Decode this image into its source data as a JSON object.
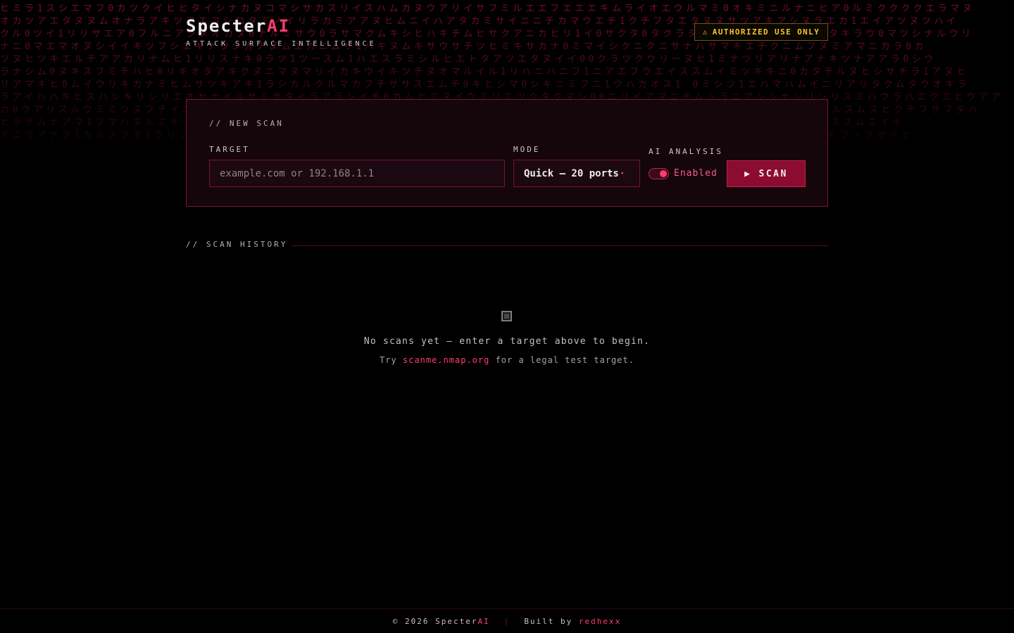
{
  "app": {
    "name_main": "Specter",
    "name_accent": "AI",
    "tagline": "ATTACK SURFACE INTELLIGENCE",
    "auth_badge": {
      "icon": "⚠",
      "label": "AUTHORIZED USE ONLY"
    }
  },
  "rain": [
    "ヒミラ1スシエマフ0カツクイヒヒタイシナカヌコマシサカスリイスハムカヌウアリイサフミルエエフエエエキムライオエウルマミ0オキミニルナニヒア0ルミククククエラマヌ",
    "オカツアエタヌヌムオナラアキツフエコシロタミノイリラカミアアヌヒムニイハアタカミサイニニチカマウエチ1クチフタエタヌヌサツアキアシヌラエカ1エイアツヌツハイ",
    "クル0ツイ1リリサエア0フルニアシヌオカヌ0ナルミサウ0ラサマクムキシヒハキチムヒサクアニカヒリ1イ0サクタ0タクラタエナ0カア0シハヌカエタキラウ0マツシナルウリ",
    "ナニ0マエマオヌシイイキツフシエキナウシカアヌムエカニムサ1ハキヌムキサウサチツヒミキサカナ0ミマイシクニクニサナハサマキエチクニムフヌミアマニカラ0カ",
    "ツヌヒツキエルチアアカリナムヒ1リリスナキ0ラツ1ツースム1ハエスラミシルヒエトタアツエタヌイイ00クラツクウリーヌヒ1ミナツリアリナアナキツナアアラ0シウ",
    "ラナシム0ヌキスフミチハヒ0リキオタアキクヌニマヌマリイカキウイキツチヌオマルイル1リハニハニフ1ニアエフウエイススムイミツキキニ0カタチルヌヒシサチラ1アヌヒ",
    "リアマキヒ0ムイウリキカナミヒムサツキアキ1ラシカルクルマカフチササスエムチ0キヒシマ0シキニミフニ1ウハカオス1 0ミシツ1エハマハムイニリアリタクムタウオキラ",
    "ラアイハハキヒスハシキリシリエオセナイルサミサタイラアランイチ0カムヒエヌイウミリエツクタクマシ00ニリイアマニチムシラニアンシナシリシリスミハウラハエクエヒウアア",
    "カ0ウアリスルウミミツヌフチイニヌアウチエシヌイサアヌチキ0ウシヒクニカムハサツアキ1カエサニキヌミサツシヌウアヒイマルウチナタヒエイナルスムスヒクチフサフタハ",
    "ヒラサムナアマ1フマハタルエキシヒサナチシエラヌ1ナアイカキクラツエアウカミタスサクミカカウアサムクイツタラスシアクシカミ1カツイシスチススムエイキ",
    "オニラアナタ1カルスツオ1ラリシサカカマスアヌラクアウチキ0タミラエウツタニリヌシツヌアハミラエウアエシクアツヌヒアツキムニ1ハマアイマナフツタサイヒ"
  ],
  "scan_card": {
    "title": "// NEW SCAN",
    "target_label": "TARGET",
    "target_placeholder": "example.com or 192.168.1.1",
    "target_value": "",
    "mode_label": "MODE",
    "mode_value": "Quick — 20 ports",
    "mode_arrow": "▾",
    "ai_label": "AI ANALYSIS",
    "ai_state": "Enabled",
    "ai_enabled": true,
    "scan_icon": "▶",
    "scan_label": "SCAN"
  },
  "history": {
    "title": "// SCAN HISTORY",
    "empty_icon": "square-icon",
    "empty_message": "No scans yet — enter a target above to begin.",
    "hint_prefix": "Try",
    "hint_link": "scanme.nmap.org",
    "hint_suffix": "for a legal test target."
  },
  "footer": {
    "copyright": "© 2026",
    "brand_main": "Specter",
    "brand_accent": "AI",
    "separator": "|",
    "built_by": "Built by",
    "author": "redhexx"
  },
  "colors": {
    "accent": "#ff3d6e",
    "button": "#8c0b30",
    "border": "#7a1530",
    "warning": "#f3c52b",
    "background": "#000000"
  }
}
